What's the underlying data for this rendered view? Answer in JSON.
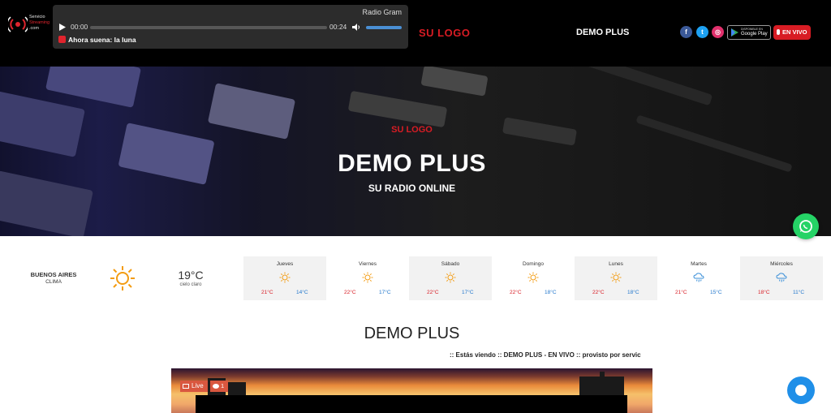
{
  "header": {
    "brand": {
      "line1": "Servicio",
      "line2": "Streaming",
      "line3": ".com"
    },
    "player": {
      "station": "Radio Gram",
      "current_time": "00:00",
      "duration": "00:24",
      "now_playing": "Ahora suena: la luna",
      "volume_level": 1.0
    },
    "logo_text": "SU LOGO",
    "station_title": "DEMO PLUS",
    "social": [
      {
        "icon": "facebook-icon",
        "glyph": "f",
        "color": "#3b5998"
      },
      {
        "icon": "twitter-icon",
        "glyph": "t",
        "color": "#1da1f2"
      },
      {
        "icon": "instagram-icon",
        "glyph": "◎",
        "color": "#e1306c"
      }
    ],
    "google_play": {
      "small": "DISPONIBLE EN",
      "big": "Google Play"
    },
    "live_button": "EN VIVO"
  },
  "hero": {
    "logo_text": "SU LOGO",
    "title": "DEMO PLUS",
    "subtitle": "SU RADIO ONLINE"
  },
  "weather": {
    "city": "BUENOS AIRES",
    "label": "CLIMA",
    "current_temp": "19°C",
    "condition": "cielo claro",
    "days": [
      {
        "name": "Jueves",
        "icon": "sun-icon",
        "hi": "21°C",
        "lo": "14°C"
      },
      {
        "name": "Viernes",
        "icon": "sun-icon",
        "hi": "22°C",
        "lo": "17°C"
      },
      {
        "name": "Sábado",
        "icon": "sun-icon",
        "hi": "22°C",
        "lo": "17°C"
      },
      {
        "name": "Domingo",
        "icon": "sun-icon",
        "hi": "22°C",
        "lo": "18°C"
      },
      {
        "name": "Lunes",
        "icon": "sun-icon",
        "hi": "22°C",
        "lo": "18°C"
      },
      {
        "name": "Martes",
        "icon": "rain-cloud-icon",
        "hi": "21°C",
        "lo": "15°C"
      },
      {
        "name": "Miércoles",
        "icon": "rain-cloud-icon",
        "hi": "18°C",
        "lo": "11°C"
      }
    ]
  },
  "main": {
    "title": "DEMO PLUS",
    "marquee": ":: Estás viendo :: DEMO PLUS - EN VIVO :: provisto por servic",
    "live_label": "Live",
    "viewer_count": "1"
  },
  "colors": {
    "accent_red": "#d81c24",
    "temp_high": "#d81c24",
    "temp_low": "#2277cc",
    "whatsapp": "#25d366",
    "chat": "#1f8fe8"
  }
}
